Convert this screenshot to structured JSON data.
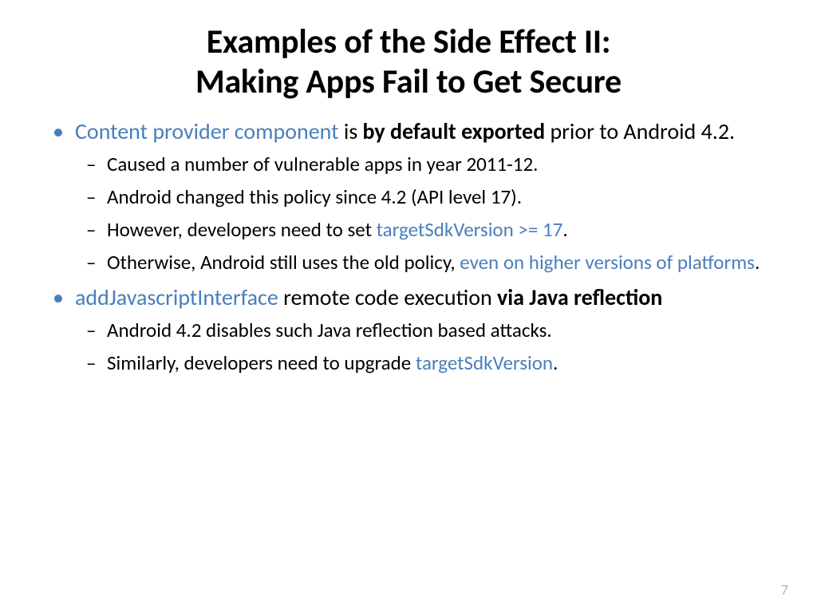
{
  "title": {
    "line1": "Examples of the Side Effect II:",
    "line2": "Making Apps Fail to Get Secure"
  },
  "bullets": [
    {
      "segments": [
        {
          "text": "Content provider component",
          "style": "link"
        },
        {
          "text": " is ",
          "style": ""
        },
        {
          "text": "by default exported",
          "style": "bold"
        },
        {
          "text": " prior to Android 4.2.",
          "style": ""
        }
      ],
      "children": [
        {
          "segments": [
            {
              "text": "Caused a number of vulnerable apps in year 2011-12.",
              "style": ""
            }
          ]
        },
        {
          "segments": [
            {
              "text": "Android changed this policy since 4.2 (API level 17).",
              "style": ""
            }
          ]
        },
        {
          "segments": [
            {
              "text": "However, developers need to set ",
              "style": ""
            },
            {
              "text": "targetSdkVersion >= 17",
              "style": "link"
            },
            {
              "text": ".",
              "style": ""
            }
          ]
        },
        {
          "segments": [
            {
              "text": "Otherwise, Android still uses the old policy, ",
              "style": ""
            },
            {
              "text": "even on higher versions of platforms",
              "style": "link"
            },
            {
              "text": ".",
              "style": ""
            }
          ]
        }
      ]
    },
    {
      "segments": [
        {
          "text": "addJavascriptInterface",
          "style": "link"
        },
        {
          "text": " remote code execution ",
          "style": ""
        },
        {
          "text": "via Java reflection",
          "style": "bold"
        }
      ],
      "children": [
        {
          "segments": [
            {
              "text": "Android 4.2 disables such Java reflection based attacks.",
              "style": ""
            }
          ]
        },
        {
          "segments": [
            {
              "text": "Similarly, developers need to upgrade ",
              "style": ""
            },
            {
              "text": "targetSdkVersion",
              "style": "link"
            },
            {
              "text": ".",
              "style": ""
            }
          ]
        }
      ]
    }
  ],
  "page_number": "7"
}
